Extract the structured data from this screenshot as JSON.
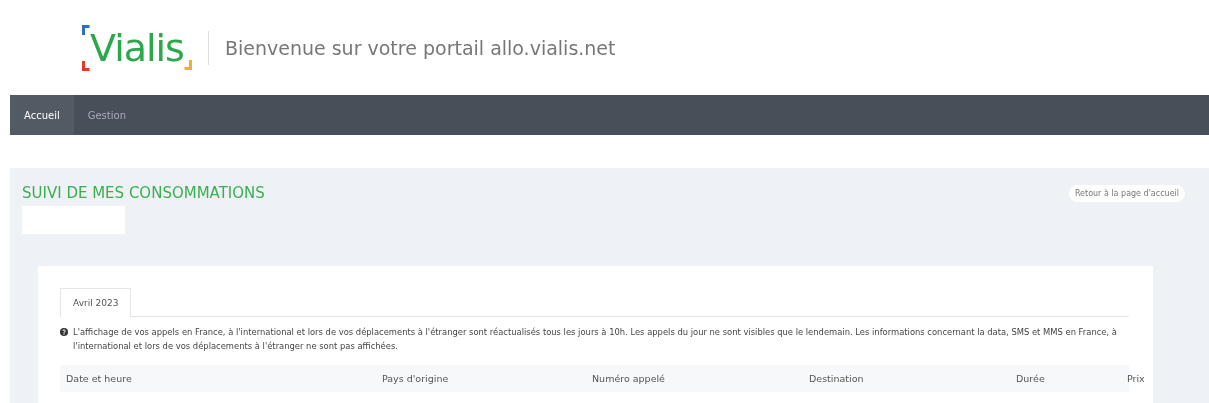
{
  "header": {
    "logo": "Vialis",
    "title": "Bienvenue sur votre portail allo.vialis.net"
  },
  "nav": [
    {
      "label": "Accueil",
      "selected": true
    },
    {
      "label": "Gestion",
      "selected": false
    }
  ],
  "page": {
    "title": "SUIVI DE MES CONSOMMATIONS",
    "back_button": "Retour à la page d'accueil"
  },
  "tabs": [
    {
      "label": "Avril 2023",
      "selected": true
    }
  ],
  "info": "L'affichage de vos appels en France, à l'international et lors de vos déplacements à l'étranger sont réactualisés tous les jours à 10h. Les appels du jour ne sont visibles que le lendemain. Les informations concernant la data, SMS et MMS en France, à l'international et lors de vos déplacements à l'étranger ne sont pas affichées.",
  "table": {
    "columns": [
      "Date et heure",
      "Pays d'origine",
      "Numéro appelé",
      "Destination",
      "Durée",
      "Prix"
    ]
  }
}
